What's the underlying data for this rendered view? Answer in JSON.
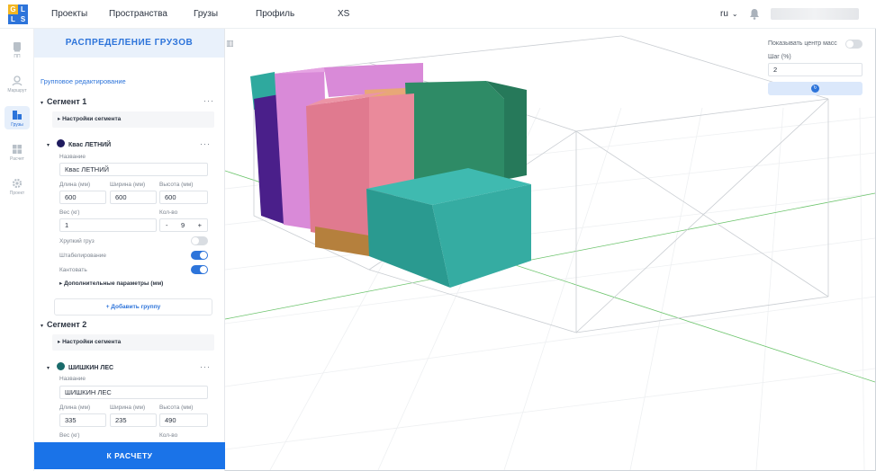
{
  "nav": {
    "items": [
      "Проекты",
      "Пространства",
      "Грузы",
      "Профиль",
      "XS"
    ],
    "lang": "ru"
  },
  "rail": {
    "items": [
      {
        "label": "ПП",
        "icon": "truck-icon"
      },
      {
        "label": "Маршрут",
        "icon": "route-icon"
      },
      {
        "label": "Грузы",
        "icon": "boxes-icon",
        "active": true
      },
      {
        "label": "Расчет",
        "icon": "calculator-icon"
      },
      {
        "label": "Проект",
        "icon": "gear-icon"
      }
    ]
  },
  "panel": {
    "title": "РАСПРЕДЕЛЕНИЕ ГРУЗОВ",
    "group_edit": "Групповое редактирование",
    "add_group": "+ Добавить группу",
    "calc_button": "К РАСЧЕТУ",
    "segments": [
      {
        "title": "Сегмент 1",
        "settings": "Настройки сегмента",
        "cargo": {
          "name": "Квас ЛЕТНИЙ",
          "color": "#1f1b5e",
          "name_label": "Название",
          "name_value": "Квас ЛЕТНИЙ",
          "length_label": "Длина (мм)",
          "width_label": "Ширина (мм)",
          "height_label": "Высота (мм)",
          "length": "600",
          "width": "600",
          "height": "600",
          "weight_label": "Вес (кг)",
          "qty_label": "Кол-во",
          "weight": "1",
          "qty": "9",
          "qty_minus": "-",
          "qty_plus": "+",
          "opt_large": "Хрупкий груз",
          "opt_stack": "Штабелирование",
          "opt_tilt": "Кантовать",
          "extra": "Дополнительные параметры (мм)"
        }
      },
      {
        "title": "Сегмент 2",
        "settings": "Настройки сегмента",
        "cargo": {
          "name": "ШИШКИН ЛЕС",
          "color": "#1a6b6b",
          "name_label": "Название",
          "name_value": "ШИШКИН ЛЕС",
          "length_label": "Длина (мм)",
          "width_label": "Ширина (мм)",
          "height_label": "Высота (мм)",
          "length": "335",
          "width": "235",
          "height": "490",
          "weight_label": "Вес (кг)",
          "qty_label": "Кол-во"
        }
      }
    ]
  },
  "right": {
    "show_center_label": "Показывать центр масс",
    "step_label": "Шаг (%)",
    "step_value": "2"
  },
  "colors": {
    "accent": "#1a73e8",
    "teal": "#2fa99e",
    "pink": "#e07a8f",
    "violet": "#d98ad8",
    "purple": "#4a1f8a",
    "orange": "#e8a778",
    "green": "#2e8b66"
  }
}
